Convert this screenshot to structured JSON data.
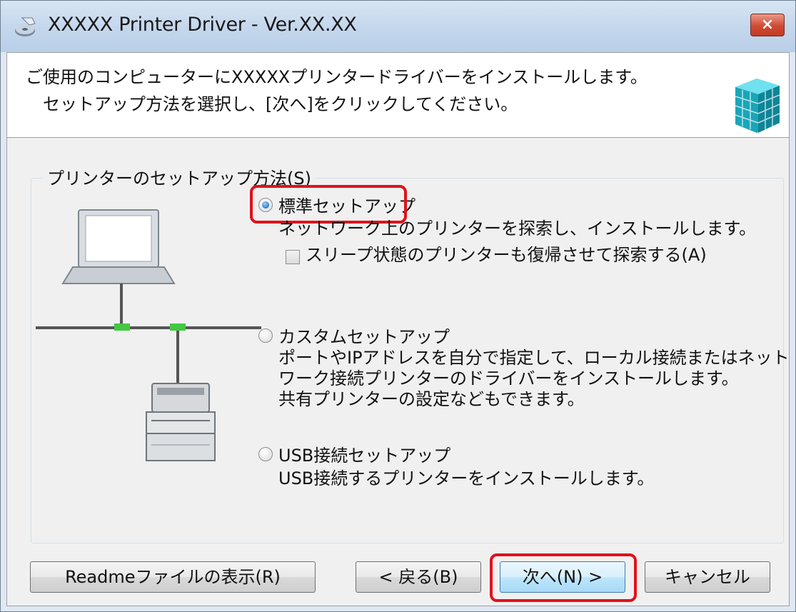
{
  "window": {
    "title": "XXXXX Printer Driver - Ver.XX.XX",
    "close_label": "×"
  },
  "header": {
    "line1": "ご使用のコンピューターにXXXXXプリンタードライバーをインストールします。",
    "line2": "セットアップ方法を選択し、[次へ]をクリックしてください。"
  },
  "group": {
    "label": "プリンターのセットアップ方法(S)"
  },
  "options": [
    {
      "label": "標準セットアップ",
      "checked": true,
      "description": [
        "ネットワーク上のプリンターを探索し、インストールします。"
      ],
      "checkbox_label": "スリープ状態のプリンターも復帰させて探索する(A)",
      "checkbox_checked": false
    },
    {
      "label": "カスタムセットアップ",
      "checked": false,
      "description": [
        "ポートやIPアドレスを自分で指定して、ローカル接続またはネット",
        "ワーク接続プリンターのドライバーをインストールします。",
        "共有プリンターの設定などもできます。"
      ]
    },
    {
      "label": "USB接続セットアップ",
      "checked": false,
      "description": [
        "USB接続するプリンターをインストールします。"
      ]
    }
  ],
  "buttons": {
    "readme": "Readmeファイルの表示(R)",
    "back": "< 戻る(B)",
    "next": "次へ(N) >",
    "cancel": "キャンセル"
  },
  "colors": {
    "highlight": "#e0121b",
    "titlebar": "#c3d6ec",
    "dialog_bg": "#f0f0f0"
  },
  "icons": [
    "installer-app-icon",
    "close-icon",
    "package-cubes-icon",
    "laptop-icon",
    "multifunction-printer-icon"
  ]
}
